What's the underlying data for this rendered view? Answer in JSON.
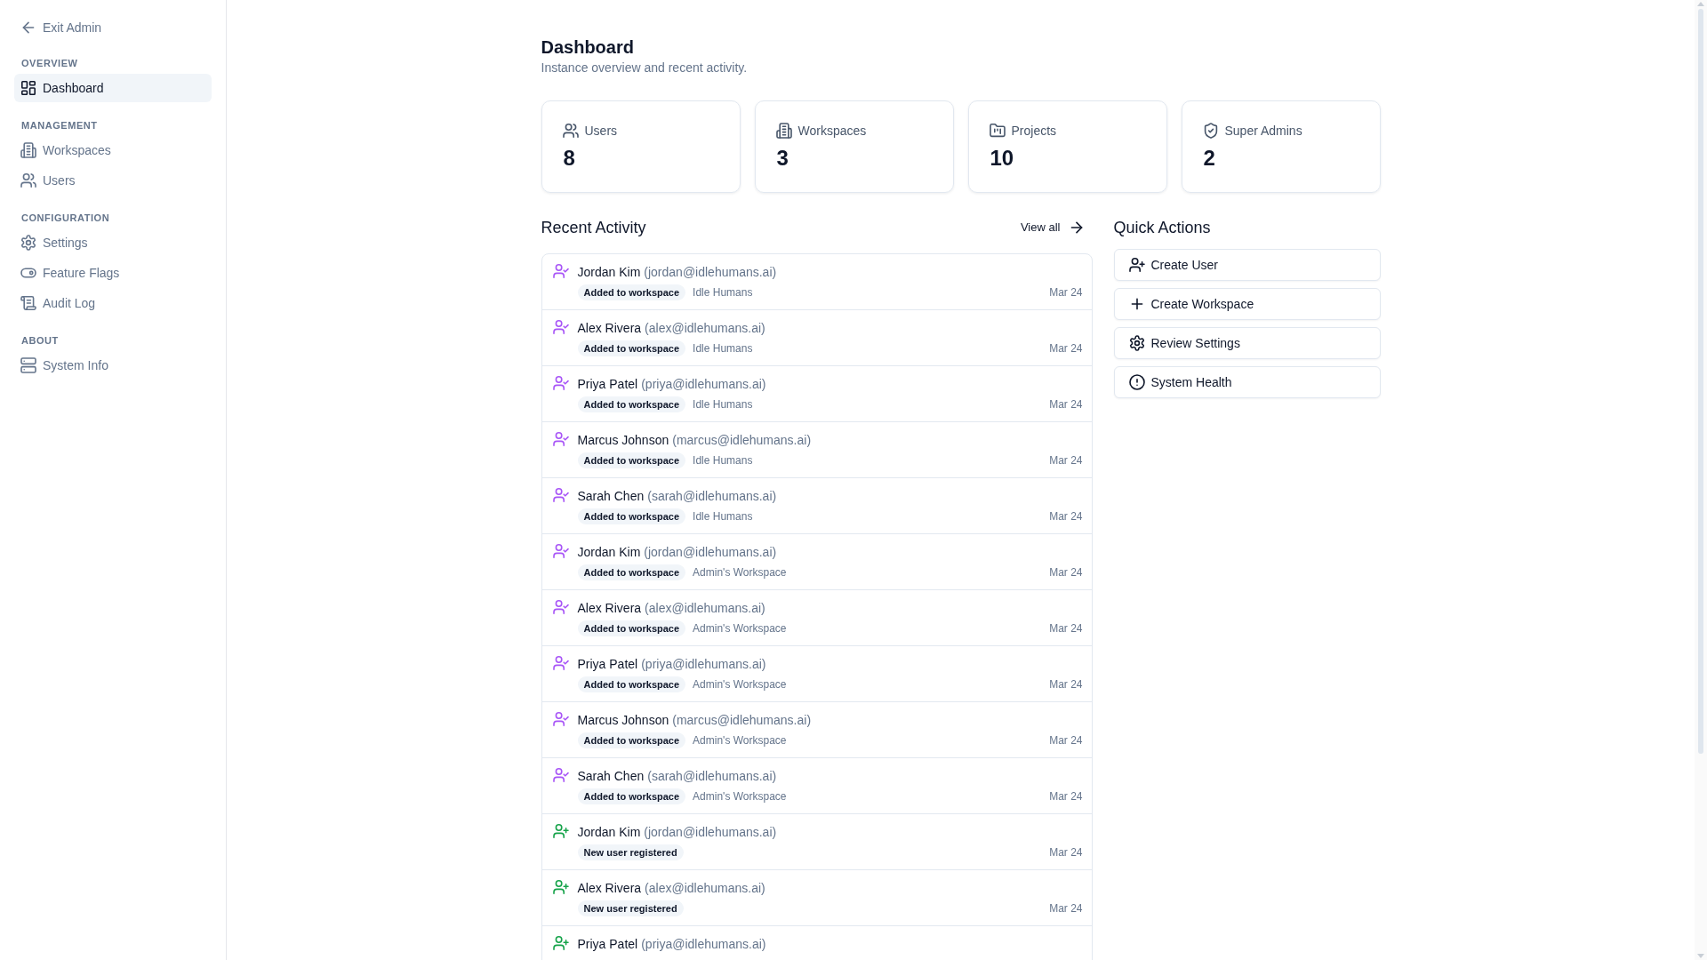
{
  "sidebar": {
    "back_link": {
      "label": "Exit Admin"
    },
    "sections": [
      {
        "heading": "OVERVIEW",
        "items": [
          {
            "label": "Dashboard",
            "selected": true
          }
        ]
      },
      {
        "heading": "MANAGEMENT",
        "items": [
          {
            "label": "Workspaces",
            "selected": false
          },
          {
            "label": "Users",
            "selected": false
          }
        ]
      },
      {
        "heading": "CONFIGURATION",
        "items": [
          {
            "label": "Settings",
            "selected": false
          },
          {
            "label": "Feature Flags",
            "selected": false
          },
          {
            "label": "Audit Log",
            "selected": false
          }
        ]
      },
      {
        "heading": "ABOUT",
        "items": [
          {
            "label": "System Info",
            "selected": false
          }
        ]
      }
    ]
  },
  "header": {
    "title": "Dashboard",
    "subtitle": "Instance overview and recent activity."
  },
  "stats": [
    {
      "label": "Users",
      "value": "8"
    },
    {
      "label": "Workspaces",
      "value": "3"
    },
    {
      "label": "Projects",
      "value": "10"
    },
    {
      "label": "Super Admins",
      "value": "2"
    }
  ],
  "recent_activity": {
    "title": "Recent Activity",
    "view_all": "View all",
    "items": [
      {
        "kind": "added",
        "name": "Jordan Kim",
        "email": "(jordan@idlehumans.ai)",
        "badge": "Added to workspace",
        "workspace": "Idle Humans",
        "date": "Mar 24"
      },
      {
        "kind": "added",
        "name": "Alex Rivera",
        "email": "(alex@idlehumans.ai)",
        "badge": "Added to workspace",
        "workspace": "Idle Humans",
        "date": "Mar 24"
      },
      {
        "kind": "added",
        "name": "Priya Patel",
        "email": "(priya@idlehumans.ai)",
        "badge": "Added to workspace",
        "workspace": "Idle Humans",
        "date": "Mar 24"
      },
      {
        "kind": "added",
        "name": "Marcus Johnson",
        "email": "(marcus@idlehumans.ai)",
        "badge": "Added to workspace",
        "workspace": "Idle Humans",
        "date": "Mar 24"
      },
      {
        "kind": "added",
        "name": "Sarah Chen",
        "email": "(sarah@idlehumans.ai)",
        "badge": "Added to workspace",
        "workspace": "Idle Humans",
        "date": "Mar 24"
      },
      {
        "kind": "added",
        "name": "Jordan Kim",
        "email": "(jordan@idlehumans.ai)",
        "badge": "Added to workspace",
        "workspace": "Admin's Workspace",
        "date": "Mar 24"
      },
      {
        "kind": "added",
        "name": "Alex Rivera",
        "email": "(alex@idlehumans.ai)",
        "badge": "Added to workspace",
        "workspace": "Admin's Workspace",
        "date": "Mar 24"
      },
      {
        "kind": "added",
        "name": "Priya Patel",
        "email": "(priya@idlehumans.ai)",
        "badge": "Added to workspace",
        "workspace": "Admin's Workspace",
        "date": "Mar 24"
      },
      {
        "kind": "added",
        "name": "Marcus Johnson",
        "email": "(marcus@idlehumans.ai)",
        "badge": "Added to workspace",
        "workspace": "Admin's Workspace",
        "date": "Mar 24"
      },
      {
        "kind": "added",
        "name": "Sarah Chen",
        "email": "(sarah@idlehumans.ai)",
        "badge": "Added to workspace",
        "workspace": "Admin's Workspace",
        "date": "Mar 24"
      },
      {
        "kind": "registered",
        "name": "Jordan Kim",
        "email": "(jordan@idlehumans.ai)",
        "badge": "New user registered",
        "date": "Mar 24"
      },
      {
        "kind": "registered",
        "name": "Alex Rivera",
        "email": "(alex@idlehumans.ai)",
        "badge": "New user registered",
        "date": "Mar 24"
      },
      {
        "kind": "registered",
        "name": "Priya Patel",
        "email": "(priya@idlehumans.ai)"
      }
    ]
  },
  "quick_actions": {
    "title": "Quick Actions",
    "items": [
      {
        "label": "Create User"
      },
      {
        "label": "Create Workspace"
      },
      {
        "label": "Review Settings"
      },
      {
        "label": "System Health"
      }
    ]
  }
}
